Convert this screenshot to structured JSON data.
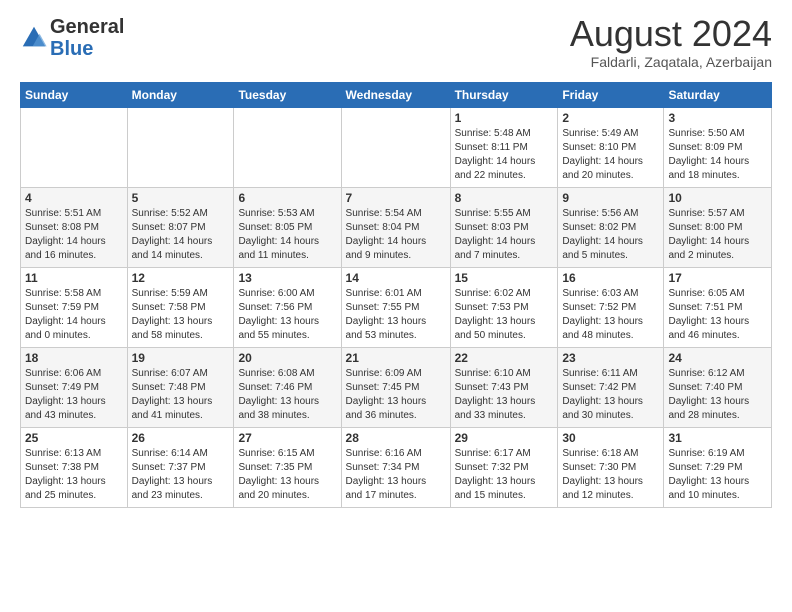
{
  "header": {
    "logo_general": "General",
    "logo_blue": "Blue",
    "month_year": "August 2024",
    "location": "Faldarli, Zaqatala, Azerbaijan"
  },
  "weekdays": [
    "Sunday",
    "Monday",
    "Tuesday",
    "Wednesday",
    "Thursday",
    "Friday",
    "Saturday"
  ],
  "weeks": [
    [
      {
        "day": "",
        "info": ""
      },
      {
        "day": "",
        "info": ""
      },
      {
        "day": "",
        "info": ""
      },
      {
        "day": "",
        "info": ""
      },
      {
        "day": "1",
        "info": "Sunrise: 5:48 AM\nSunset: 8:11 PM\nDaylight: 14 hours\nand 22 minutes."
      },
      {
        "day": "2",
        "info": "Sunrise: 5:49 AM\nSunset: 8:10 PM\nDaylight: 14 hours\nand 20 minutes."
      },
      {
        "day": "3",
        "info": "Sunrise: 5:50 AM\nSunset: 8:09 PM\nDaylight: 14 hours\nand 18 minutes."
      }
    ],
    [
      {
        "day": "4",
        "info": "Sunrise: 5:51 AM\nSunset: 8:08 PM\nDaylight: 14 hours\nand 16 minutes."
      },
      {
        "day": "5",
        "info": "Sunrise: 5:52 AM\nSunset: 8:07 PM\nDaylight: 14 hours\nand 14 minutes."
      },
      {
        "day": "6",
        "info": "Sunrise: 5:53 AM\nSunset: 8:05 PM\nDaylight: 14 hours\nand 11 minutes."
      },
      {
        "day": "7",
        "info": "Sunrise: 5:54 AM\nSunset: 8:04 PM\nDaylight: 14 hours\nand 9 minutes."
      },
      {
        "day": "8",
        "info": "Sunrise: 5:55 AM\nSunset: 8:03 PM\nDaylight: 14 hours\nand 7 minutes."
      },
      {
        "day": "9",
        "info": "Sunrise: 5:56 AM\nSunset: 8:02 PM\nDaylight: 14 hours\nand 5 minutes."
      },
      {
        "day": "10",
        "info": "Sunrise: 5:57 AM\nSunset: 8:00 PM\nDaylight: 14 hours\nand 2 minutes."
      }
    ],
    [
      {
        "day": "11",
        "info": "Sunrise: 5:58 AM\nSunset: 7:59 PM\nDaylight: 14 hours\nand 0 minutes."
      },
      {
        "day": "12",
        "info": "Sunrise: 5:59 AM\nSunset: 7:58 PM\nDaylight: 13 hours\nand 58 minutes."
      },
      {
        "day": "13",
        "info": "Sunrise: 6:00 AM\nSunset: 7:56 PM\nDaylight: 13 hours\nand 55 minutes."
      },
      {
        "day": "14",
        "info": "Sunrise: 6:01 AM\nSunset: 7:55 PM\nDaylight: 13 hours\nand 53 minutes."
      },
      {
        "day": "15",
        "info": "Sunrise: 6:02 AM\nSunset: 7:53 PM\nDaylight: 13 hours\nand 50 minutes."
      },
      {
        "day": "16",
        "info": "Sunrise: 6:03 AM\nSunset: 7:52 PM\nDaylight: 13 hours\nand 48 minutes."
      },
      {
        "day": "17",
        "info": "Sunrise: 6:05 AM\nSunset: 7:51 PM\nDaylight: 13 hours\nand 46 minutes."
      }
    ],
    [
      {
        "day": "18",
        "info": "Sunrise: 6:06 AM\nSunset: 7:49 PM\nDaylight: 13 hours\nand 43 minutes."
      },
      {
        "day": "19",
        "info": "Sunrise: 6:07 AM\nSunset: 7:48 PM\nDaylight: 13 hours\nand 41 minutes."
      },
      {
        "day": "20",
        "info": "Sunrise: 6:08 AM\nSunset: 7:46 PM\nDaylight: 13 hours\nand 38 minutes."
      },
      {
        "day": "21",
        "info": "Sunrise: 6:09 AM\nSunset: 7:45 PM\nDaylight: 13 hours\nand 36 minutes."
      },
      {
        "day": "22",
        "info": "Sunrise: 6:10 AM\nSunset: 7:43 PM\nDaylight: 13 hours\nand 33 minutes."
      },
      {
        "day": "23",
        "info": "Sunrise: 6:11 AM\nSunset: 7:42 PM\nDaylight: 13 hours\nand 30 minutes."
      },
      {
        "day": "24",
        "info": "Sunrise: 6:12 AM\nSunset: 7:40 PM\nDaylight: 13 hours\nand 28 minutes."
      }
    ],
    [
      {
        "day": "25",
        "info": "Sunrise: 6:13 AM\nSunset: 7:38 PM\nDaylight: 13 hours\nand 25 minutes."
      },
      {
        "day": "26",
        "info": "Sunrise: 6:14 AM\nSunset: 7:37 PM\nDaylight: 13 hours\nand 23 minutes."
      },
      {
        "day": "27",
        "info": "Sunrise: 6:15 AM\nSunset: 7:35 PM\nDaylight: 13 hours\nand 20 minutes."
      },
      {
        "day": "28",
        "info": "Sunrise: 6:16 AM\nSunset: 7:34 PM\nDaylight: 13 hours\nand 17 minutes."
      },
      {
        "day": "29",
        "info": "Sunrise: 6:17 AM\nSunset: 7:32 PM\nDaylight: 13 hours\nand 15 minutes."
      },
      {
        "day": "30",
        "info": "Sunrise: 6:18 AM\nSunset: 7:30 PM\nDaylight: 13 hours\nand 12 minutes."
      },
      {
        "day": "31",
        "info": "Sunrise: 6:19 AM\nSunset: 7:29 PM\nDaylight: 13 hours\nand 10 minutes."
      }
    ]
  ]
}
